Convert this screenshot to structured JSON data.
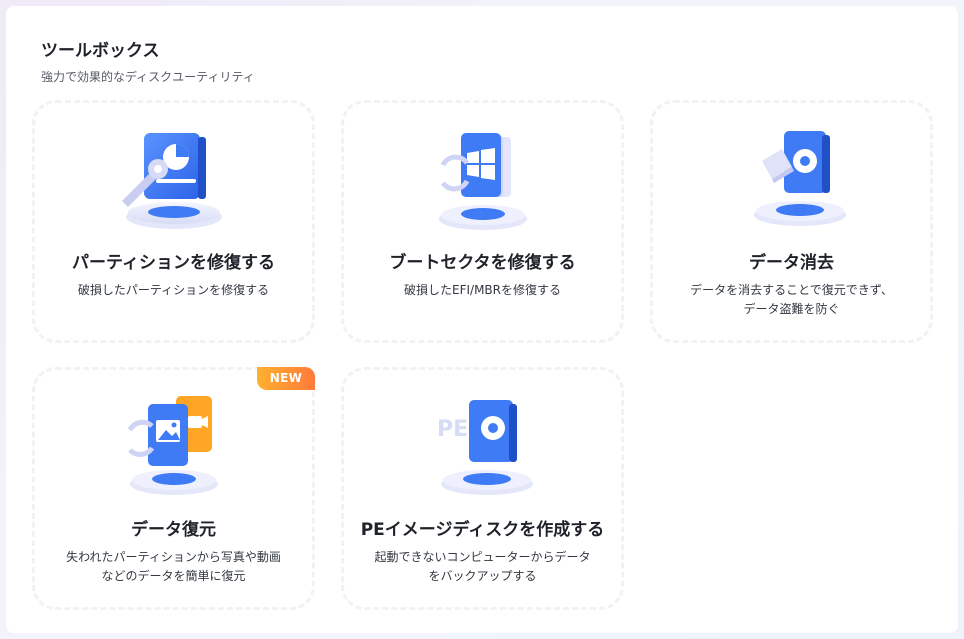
{
  "header": {
    "title": "ツールボックス",
    "subtitle": "強力で効果的なディスクユーティリティ"
  },
  "cards": [
    {
      "title": "パーティションを修復する",
      "desc": "破損したパーティションを修復する",
      "icon": "partition-repair-icon"
    },
    {
      "title": "ブートセクタを修復する",
      "desc": "破損したEFI/MBRを修復する",
      "icon": "boot-sector-repair-icon"
    },
    {
      "title": "データ消去",
      "desc": "データを消去することで復元できず、\nデータ盗難を防ぐ",
      "icon": "data-wipe-icon"
    },
    {
      "title": "データ復元",
      "desc": "失われたパーティションから写真や動画\nなどのデータを簡単に復元",
      "icon": "data-recovery-icon",
      "badge": "NEW"
    },
    {
      "title": "PEイメージディスクを作成する",
      "desc": "起動できないコンピューターからデータ\nをバックアップする",
      "icon": "pe-image-disk-icon"
    }
  ],
  "colors": {
    "accent_blue": "#3f7bf5",
    "badge_orange": "#ff7a3d"
  }
}
